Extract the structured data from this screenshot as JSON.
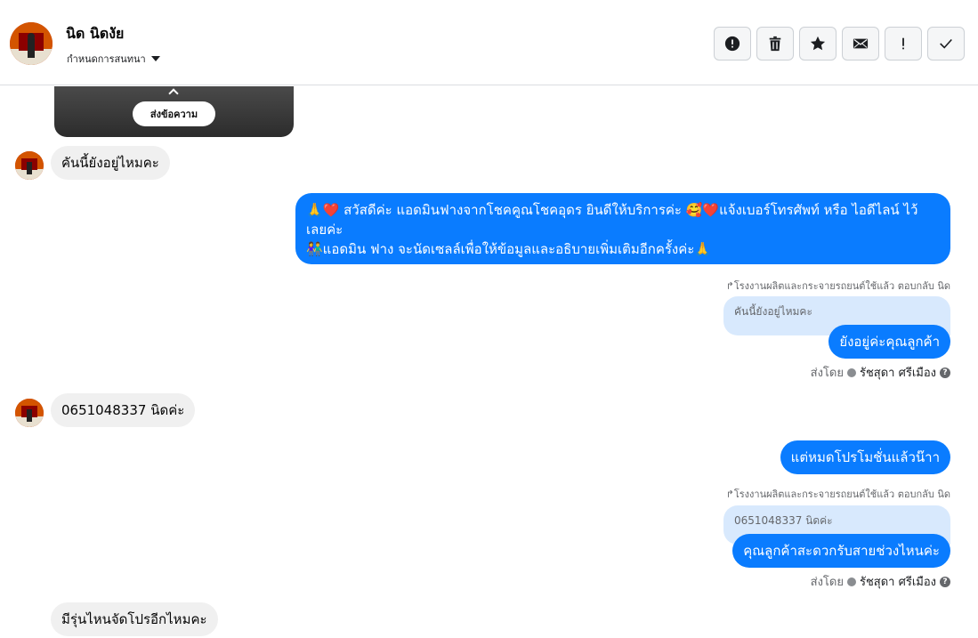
{
  "header": {
    "name": "นิด นิดงัย",
    "subtitle": "กำหนดการสนทนา",
    "toolbar": [
      "alert-icon",
      "trash-icon",
      "star-icon",
      "mail-icon",
      "exclamation-icon",
      "check-icon"
    ]
  },
  "preview_card": {
    "button_label": "ส่งข้อความ"
  },
  "messages": {
    "m1": "คันนี้ยังอยู่ไหมคะ",
    "m2_line1": "🙏❤️ สวัสดีค่ะ แอดมินฟางจากโชคคูณโชคอุดร ยินดีให้บริการค่ะ 🥰❤️แจ้งเบอร์โทรศัพท์ หรือ ไอดีไลน์ ไว้",
    "m2_line2": "เลยค่ะ",
    "m2_line3": "👫แอดมิน ฟาง จะนัดเซลล์เพื่อให้ข้อมูลและอธิบายเพิ่มเติมอีกครั้งค่ะ🙏",
    "reply1_meta": "โรงงานผลิตและกระจายรถยนต์ใช้แล้ว ตอบกลับ นิด",
    "reply1_quote": "คันนี้ยังอยู่ไหมคะ",
    "m3": "ยังอยู่ค่ะคุณลูกค้า",
    "sent_by_label": "ส่งโดย",
    "sent_by_name": "รัชสุดา ศรีเมือง",
    "m4": "0651048337 นิดค่ะ",
    "m5": "แต่หมดโปรโมชั่นแล้วน๊าา",
    "reply2_meta": "โรงงานผลิตและกระจายรถยนต์ใช้แล้ว ตอบกลับ นิด",
    "reply2_quote": "0651048337 นิดค่ะ",
    "m6": "คุณลูกค้าสะดวกรับสายช่วงไหนค่ะ",
    "sent_by_label2": "ส่งโดย",
    "sent_by_name2": "รัชสุดา ศรีเมือง",
    "m7": "มีรุ่นไหนจัดโปรอีกไหมคะ"
  }
}
